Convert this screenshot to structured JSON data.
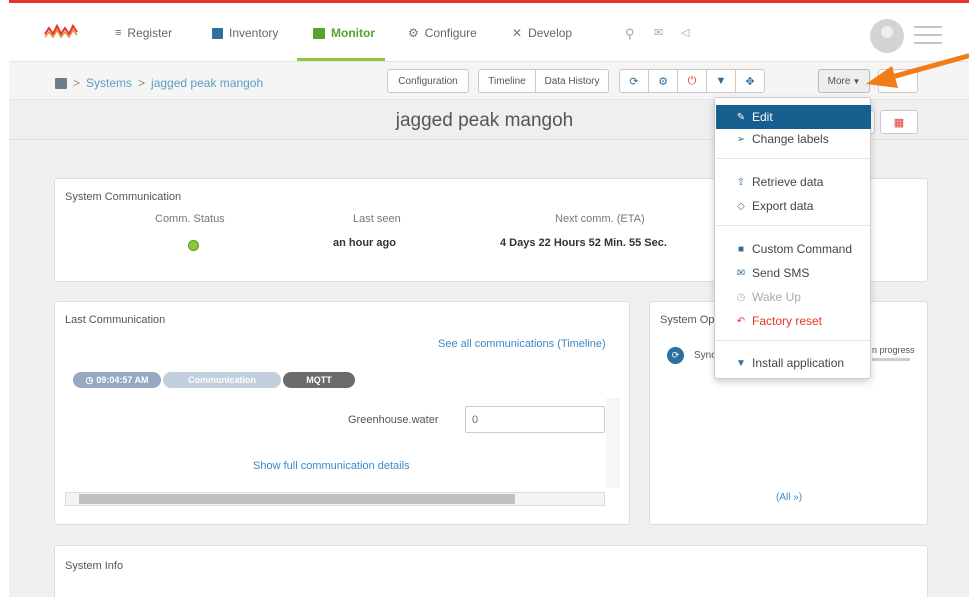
{
  "nav": {
    "items": [
      {
        "label": "Register",
        "icon": "register-icon"
      },
      {
        "label": "Inventory",
        "icon": "inventory-icon"
      },
      {
        "label": "Monitor",
        "icon": "monitor-icon"
      },
      {
        "label": "Configure",
        "icon": "gear-icon"
      },
      {
        "label": "Develop",
        "icon": "tools-icon"
      }
    ]
  },
  "breadcrumb": {
    "systems": "Systems",
    "sep": ">",
    "current": "jagged peak mangoh"
  },
  "toolbar": {
    "configuration": "Configuration",
    "timeline": "Timeline",
    "data_history": "Data History",
    "more": "More"
  },
  "page": {
    "title": "jagged peak mangoh"
  },
  "comm": {
    "title": "System Communication",
    "status_label": "Comm. Status",
    "last_seen_label": "Last seen",
    "last_seen_value": "an hour ago",
    "next_label": "Next comm. (ETA)",
    "next_value": "4 Days 22 Hours 52 Min. 55 Sec."
  },
  "last": {
    "title": "Last Communication",
    "see_all": "See all communications (Timeline)",
    "time": "09:04:57 AM",
    "type": "Communication",
    "protocol": "MQTT",
    "field_label": "Greenhouse.water",
    "field_value": "0",
    "show_details": "Show full communication details"
  },
  "ops": {
    "title": "System Op",
    "sync": "Sync",
    "progress": "n progress",
    "all": "(All »)"
  },
  "info": {
    "title": "System Info"
  },
  "dropdown": {
    "edit": "Edit",
    "change_labels": "Change labels",
    "retrieve": "Retrieve data",
    "export": "Export data",
    "custom_command": "Custom Command",
    "send_sms": "Send SMS",
    "wake_up": "Wake Up",
    "factory_reset": "Factory reset",
    "install": "Install application"
  },
  "colors": {
    "brand_red": "#e3352b",
    "monitor_green": "#8dc63f",
    "link_blue": "#3a89c9",
    "menu_active": "#165f8f",
    "arrow_orange": "#f07d18"
  }
}
